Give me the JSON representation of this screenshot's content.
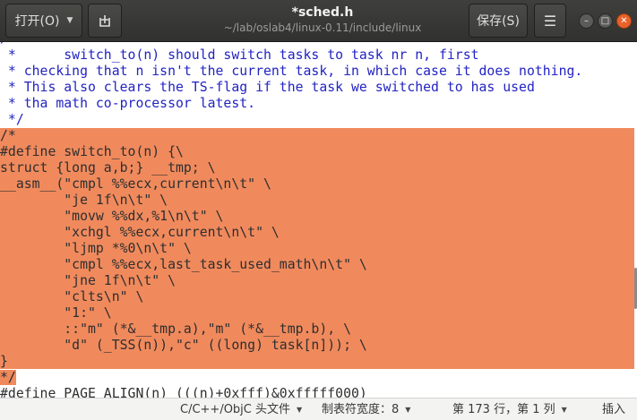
{
  "header": {
    "open_label": "打开(O)",
    "save_label": "保存(S)",
    "title": "*sched.h",
    "subtitle": "~/lab/oslab4/linux-0.11/include/linux"
  },
  "editor": {
    "lines": [
      " *      switch_to(n) should switch tasks to task nr n, first",
      " * checking that n isn't the current task, in which case it does nothing.",
      " * This also clears the TS-flag if the task we switched to has used",
      " * tha math co-processor latest.",
      " */",
      "/*",
      "#define switch_to(n) {\\",
      "struct {long a,b;} __tmp; \\",
      "__asm__(\"cmpl %%ecx,current\\n\\t\" \\",
      "        \"je 1f\\n\\t\" \\",
      "        \"movw %%dx,%1\\n\\t\" \\",
      "        \"xchgl %%ecx,current\\n\\t\" \\",
      "        \"ljmp *%0\\n\\t\" \\",
      "        \"cmpl %%ecx,last_task_used_math\\n\\t\" \\",
      "        \"jne 1f\\n\\t\" \\",
      "        \"clts\\n\" \\",
      "        \"1:\" \\",
      "        ::\"m\" (*&__tmp.a),\"m\" (*&__tmp.b), \\",
      "        \"d\" (_TSS(n)),\"c\" ((long) task[n])); \\",
      "}",
      "*/",
      "#define PAGE_ALIGN(n) (((n)+0xfff)&0xfffff000)"
    ]
  },
  "statusbar": {
    "language": "C/C++/ObjC 头文件",
    "tab_width": "制表符宽度：8",
    "position": "第 173 行，第 1 列",
    "mode": "插入"
  }
}
